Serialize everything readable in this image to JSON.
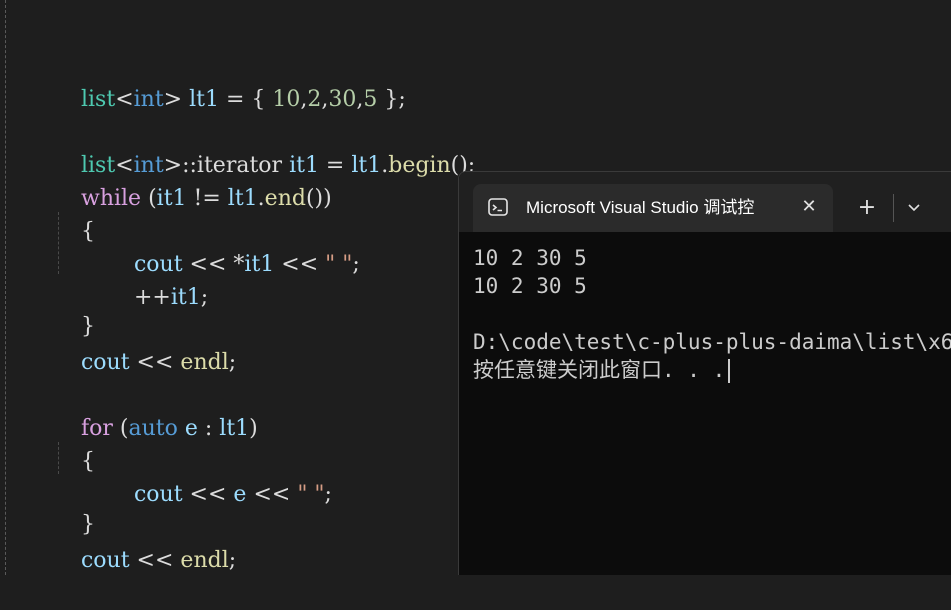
{
  "editor": {
    "lines": {
      "l1": {
        "t1": "list",
        "t2": "<",
        "t3": "int",
        "t4": "> ",
        "t5": "lt1",
        "t6": " = { ",
        "t7": "10",
        "t8": ",",
        "t9": "2",
        "t10": ",",
        "t11": "30",
        "t12": ",",
        "t13": "5",
        "t14": " };"
      },
      "l2": {
        "t1": "list",
        "t2": "<",
        "t3": "int",
        "t4": ">::iterator ",
        "t5": "it1",
        "t6": " = ",
        "t7": "lt1",
        "t8": ".",
        "t9": "begin",
        "t10": "();"
      },
      "l3": {
        "t1": "while",
        "t2": " (",
        "t3": "it1",
        "t4": " != ",
        "t5": "lt1",
        "t6": ".",
        "t7": "end",
        "t8": "())"
      },
      "l4": {
        "t1": "{"
      },
      "l5": {
        "t1": "cout",
        "t2": " << *",
        "t3": "it1",
        "t4": " << ",
        "t5": "\" \"",
        "t6": ";"
      },
      "l6": {
        "t1": "++",
        "t2": "it1",
        "t3": ";"
      },
      "l7": {
        "t1": "}"
      },
      "l8": {
        "t1": "cout",
        "t2": " << ",
        "t3": "endl",
        "t4": ";"
      },
      "l9": {
        "t1": "for",
        "t2": " (",
        "t3": "auto",
        "t4": " ",
        "t5": "e",
        "t6": " : ",
        "t7": "lt1",
        "t8": ")"
      },
      "l10": {
        "t1": "{"
      },
      "l11": {
        "t1": "cout",
        "t2": " << ",
        "t3": "e",
        "t4": " << ",
        "t5": "\" \"",
        "t6": ";"
      },
      "l12": {
        "t1": "}"
      },
      "l13": {
        "t1": "cout",
        "t2": " << ",
        "t3": "endl",
        "t4": ";"
      }
    }
  },
  "terminal": {
    "tab_title": "Microsoft Visual Studio 调试控",
    "tab_icon": "terminal-icon",
    "close_glyph": "✕",
    "new_tab_glyph": "+",
    "output": [
      "10 2 30 5",
      "10 2 30 5",
      "",
      "D:\\code\\test\\c-plus-plus-daima\\list\\x6",
      "按任意键关闭此窗口. . ."
    ]
  },
  "colors": {
    "editor_bg": "#1e1e1e",
    "keyword": "#d8a0df",
    "type": "#569cd6",
    "number": "#b5cea8",
    "string": "#d69d85",
    "function": "#dcdcaa",
    "terminal_bg": "#0c0c0c"
  }
}
